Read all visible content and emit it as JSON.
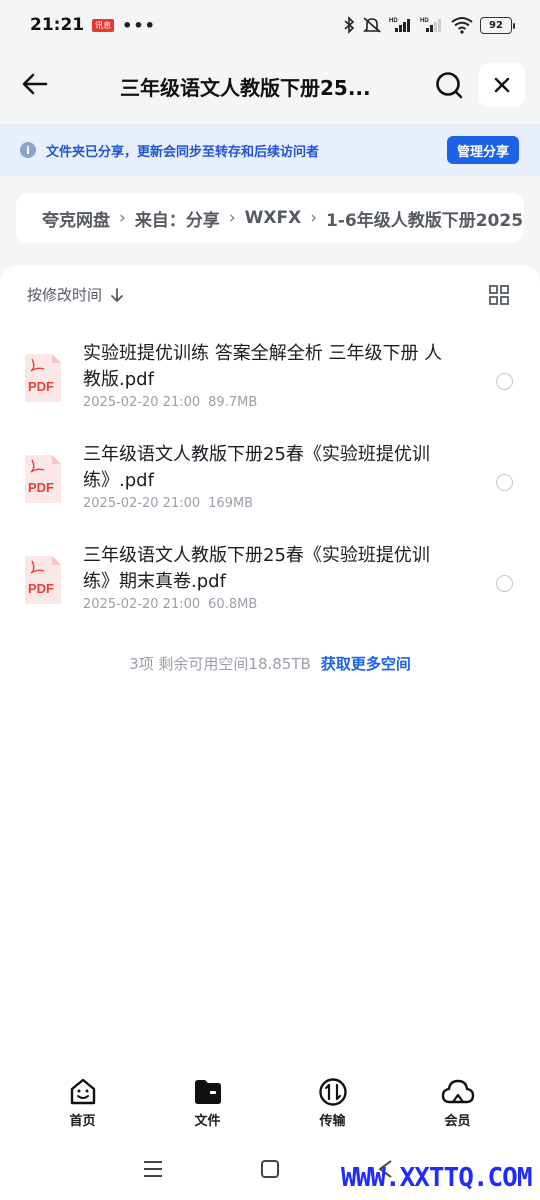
{
  "status_bar": {
    "time": "21:21",
    "badge": "讯息",
    "battery": "92"
  },
  "header": {
    "title": "三年级语文人教版下册25..."
  },
  "share_banner": {
    "text": "文件夹已分享，更新会同步至转存和后续访问者",
    "button": "管理分享"
  },
  "breadcrumb": {
    "root": "夸克网盘",
    "from_label": "来自：",
    "items": [
      "分享",
      "WXFX",
      "1-6年级人教版下册2025"
    ]
  },
  "sort": {
    "label": "按修改时间"
  },
  "files": [
    {
      "name": "实验班提优训练 答案全解全析 三年级下册 人教版.pdf",
      "date": "2025-02-20 21:00",
      "size": "89.7MB",
      "icon": "PDF"
    },
    {
      "name": "三年级语文人教版下册25春《实验班提优训练》.pdf",
      "date": "2025-02-20 21:00",
      "size": "169MB",
      "icon": "PDF"
    },
    {
      "name": "三年级语文人教版下册25春《实验班提优训练》期末真卷.pdf",
      "date": "2025-02-20 21:00",
      "size": "60.8MB",
      "icon": "PDF"
    }
  ],
  "footer": {
    "summary": "3项 剩余可用空间18.85TB",
    "link": "获取更多空间"
  },
  "nav": [
    {
      "label": "首页",
      "icon": "home-smile-icon"
    },
    {
      "label": "文件",
      "icon": "folder-icon"
    },
    {
      "label": "传输",
      "icon": "transfer-icon"
    },
    {
      "label": "会员",
      "icon": "cloud-icon"
    }
  ],
  "watermark": "WWW.XXTTQ.COM",
  "colors": {
    "accent": "#1d63ea",
    "banner_bg": "#e9eefb",
    "pdf_red": "#e5403a"
  }
}
